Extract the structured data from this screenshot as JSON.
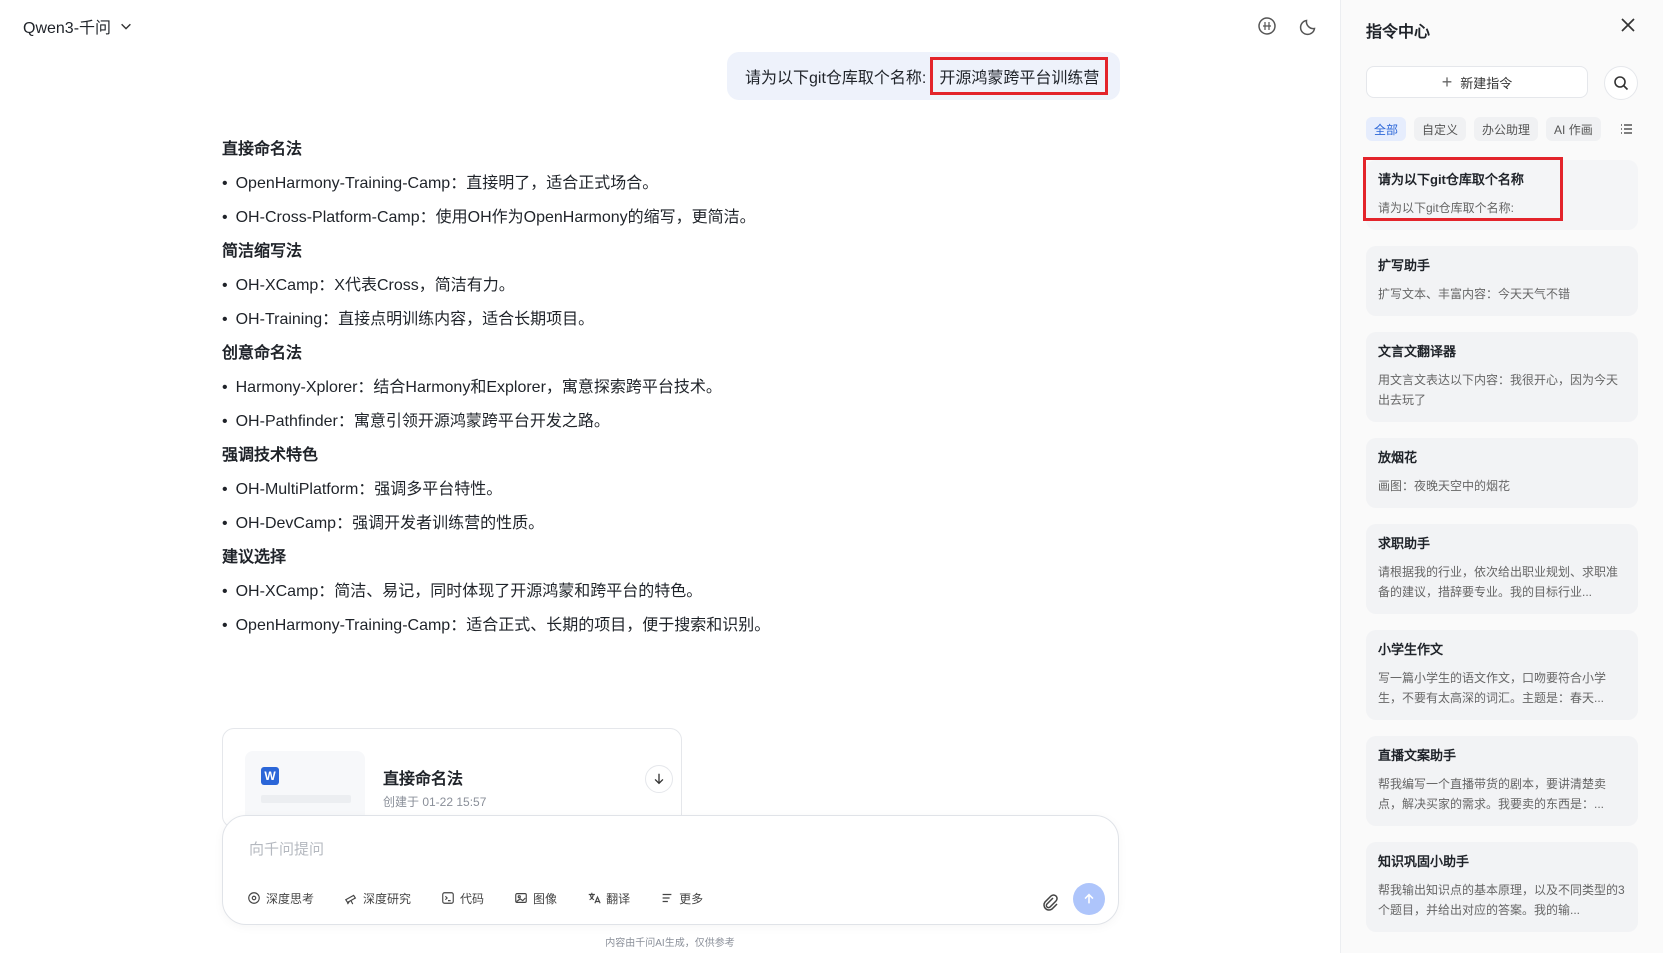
{
  "header": {
    "model_label": "Qwen3-千问"
  },
  "conversation": {
    "user_prefix": "请为以下git仓库取个名称:",
    "user_highlight": "开源鸿蒙跨平台训练营",
    "answer": [
      {
        "title": "直接命名法",
        "items": [
          "OpenHarmony-Training-Camp：直接明了，适合正式场合。",
          "OH-Cross-Platform-Camp：使用OH作为OpenHarmony的缩写，更简洁。"
        ]
      },
      {
        "title": "简洁缩写法",
        "items": [
          "OH-XCamp：X代表Cross，简洁有力。",
          "OH-Training：直接点明训练内容，适合长期项目。"
        ]
      },
      {
        "title": "创意命名法",
        "items": [
          "Harmony-Xplorer：结合Harmony和Explorer，寓意探索跨平台技术。",
          "OH-Pathfinder：寓意引领开源鸿蒙跨平台开发之路。"
        ]
      },
      {
        "title": "强调技术特色",
        "items": [
          "OH-MultiPlatform：强调多平台特性。",
          "OH-DevCamp：强调开发者训练营的性质。"
        ]
      },
      {
        "title": "建议选择",
        "items": [
          "OH-XCamp：简洁、易记，同时体现了开源鸿蒙和跨平台的特色。",
          "OpenHarmony-Training-Camp：适合正式、长期的项目，便于搜索和识别。"
        ]
      }
    ],
    "doc_card": {
      "badge": "W",
      "title": "直接命名法",
      "meta": "创建于 01-22 15:57"
    }
  },
  "composer": {
    "placeholder": "向千问提问",
    "tools": [
      {
        "name": "deep-think",
        "label": "深度思考"
      },
      {
        "name": "deep-research",
        "label": "深度研究"
      },
      {
        "name": "code",
        "label": "代码"
      },
      {
        "name": "image",
        "label": "图像"
      },
      {
        "name": "translate",
        "label": "翻译"
      },
      {
        "name": "more",
        "label": "更多"
      }
    ],
    "disclaimer": "内容由千问AI生成，仅供参考"
  },
  "panel": {
    "title": "指令中心",
    "new_label": "新建指令",
    "tabs": [
      "全部",
      "自定义",
      "办公助理",
      "AI 作画"
    ],
    "cards": [
      {
        "title": "请为以下git仓库取个名称",
        "desc": "请为以下git仓库取个名称:"
      },
      {
        "title": "扩写助手",
        "desc": "扩写文本、丰富内容：今天天气不错"
      },
      {
        "title": "文言文翻译器",
        "desc": "用文言文表达以下内容：我很开心，因为今天出去玩了"
      },
      {
        "title": "放烟花",
        "desc": "画图：夜晚天空中的烟花"
      },
      {
        "title": "求职助手",
        "desc": "请根据我的行业，依次给出职业规划、求职准备的建议，措辞要专业。我的目标行业..."
      },
      {
        "title": "小学生作文",
        "desc": "写一篇小学生的语文作文，口吻要符合小学生，不要有太高深的词汇。主题是：春天..."
      },
      {
        "title": "直播文案助手",
        "desc": "帮我编写一个直播带货的剧本，要讲清楚卖点，解决买家的需求。我要卖的东西是：..."
      },
      {
        "title": "知识巩固小助手",
        "desc": "帮我输出知识点的基本原理，以及不同类型的3个题目，并给出对应的答案。我的输..."
      }
    ]
  }
}
